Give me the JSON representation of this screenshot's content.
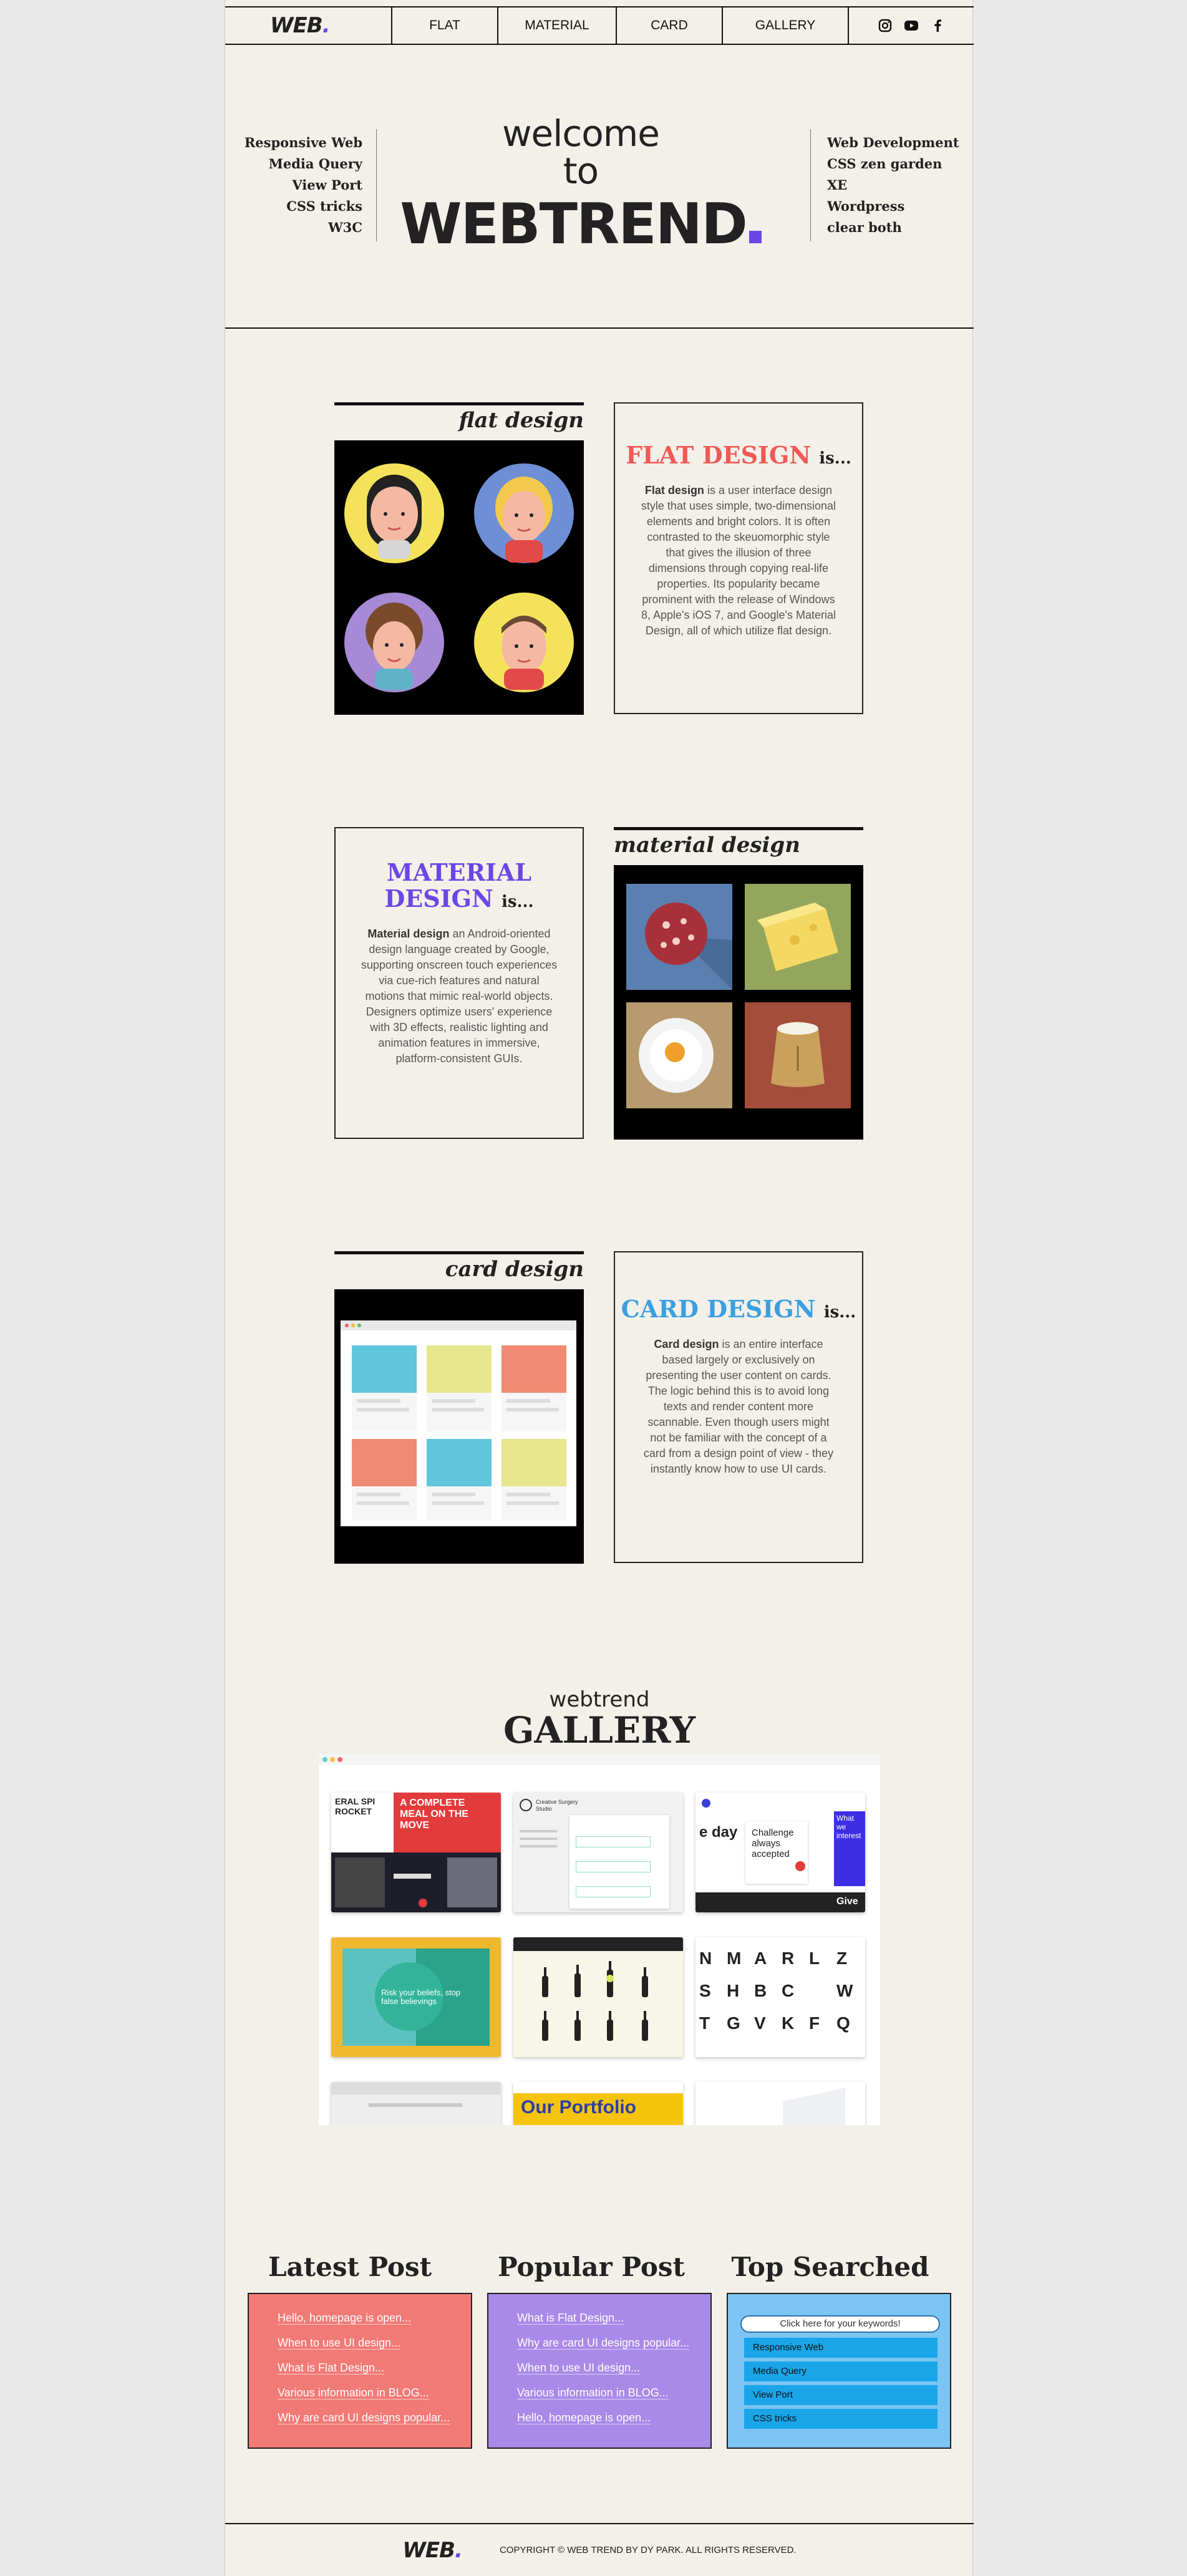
{
  "header": {
    "logo_text": "WEB",
    "logo_dot": ".",
    "nav": [
      "FLAT",
      "MATERIAL",
      "CARD",
      "GALLERY"
    ],
    "social_icons": [
      "instagram-icon",
      "youtube-icon",
      "facebook-icon"
    ]
  },
  "hero": {
    "left_links": [
      "Responsive Web",
      "Media Query",
      "View Port",
      "CSS tricks",
      "W3C"
    ],
    "right_links": [
      "Web Development",
      "CSS zen garden",
      "XE",
      "Wordpress",
      "clear both"
    ],
    "welcome": "welcome",
    "to": "to",
    "brand": "WEBTREND"
  },
  "flat": {
    "label": "flat design",
    "title": "FLAT DESIGN",
    "title_color": "#ef5a55",
    "is": "is...",
    "strong": "Flat design",
    "text": " is a user interface design style that uses simple, two-dimensional elements and bright colors. It is often contrasted to the skeuomorphic style that gives the illusion of three dimensions through copying real-life properties. Its popularity became prominent with the release of Windows 8, Apple's iOS 7, and Google's Material Design, all of which utilize flat design."
  },
  "material": {
    "label": "material design",
    "title_line1": "MATERIAL",
    "title_line2": "DESIGN",
    "title_color": "#6b46e5",
    "is": "is...",
    "strong": "Material design",
    "text": " an Android-oriented design language created by Google, supporting onscreen touch experiences via cue-rich features and natural motions that mimic real-world objects. Designers optimize users' experience with 3D effects, realistic lighting and animation features in immersive, platform-consistent GUIs."
  },
  "card": {
    "label": "card design",
    "title": "CARD DESIGN",
    "title_color": "#3aa0e0",
    "is": "is...",
    "strong": "Card design",
    "text": " is an entire interface based largely or exclusively on presenting the user content on cards. The logic behind this is to avoid long texts and render content more scannable. Even though users might not be familiar with the concept of a card from a design point of view - they instantly know how to use UI cards."
  },
  "gallery": {
    "subtitle": "webtrend",
    "title": "GALLERY",
    "tile1_text": "A COMPLETE MEAL ON THE MOVE",
    "tile1_side": "ERAL SPI ROCKET",
    "tile2_title": "Creative Surgery Studio",
    "tile3_big": "Challenge always accepted",
    "tile3_left": "e day",
    "tile3_right": "What we interest",
    "tile3_give": "Give",
    "tile4_text": "Risk your beliefs, stop false believings",
    "tile6_letters": [
      "N",
      "M",
      "A",
      "R",
      "L",
      "Z",
      "S",
      "H",
      "B",
      "C",
      "",
      "W",
      "T",
      "G",
      "V",
      "K",
      "F",
      "Q"
    ],
    "tile8_text": "Our Portfolio"
  },
  "latest": {
    "title": "Latest Post",
    "color": "#f27a76",
    "items": [
      "Hello, homepage is open...",
      "When to use UI design...",
      "What is Flat Design...",
      "Various information in BLOG...",
      "Why are card UI designs popular..."
    ]
  },
  "popular": {
    "title": "Popular Post",
    "color": "#a98ae8",
    "items": [
      "What is Flat Design...",
      "Why are card UI designs popular...",
      "When to use UI design...",
      "Various information in BLOG...",
      "Hello, homepage is open..."
    ]
  },
  "top": {
    "title": "Top Searched",
    "color": "#7cc4f2",
    "search_placeholder": "Click here for your keywords!",
    "items": [
      "Responsive Web",
      "Media Query",
      "View Port",
      "CSS tricks"
    ]
  },
  "footer": {
    "logo_text": "WEB",
    "logo_dot": ".",
    "copyright": "COPYRIGHT © WEB TREND BY DY PARK. ALL RIGHTS RESERVED."
  }
}
